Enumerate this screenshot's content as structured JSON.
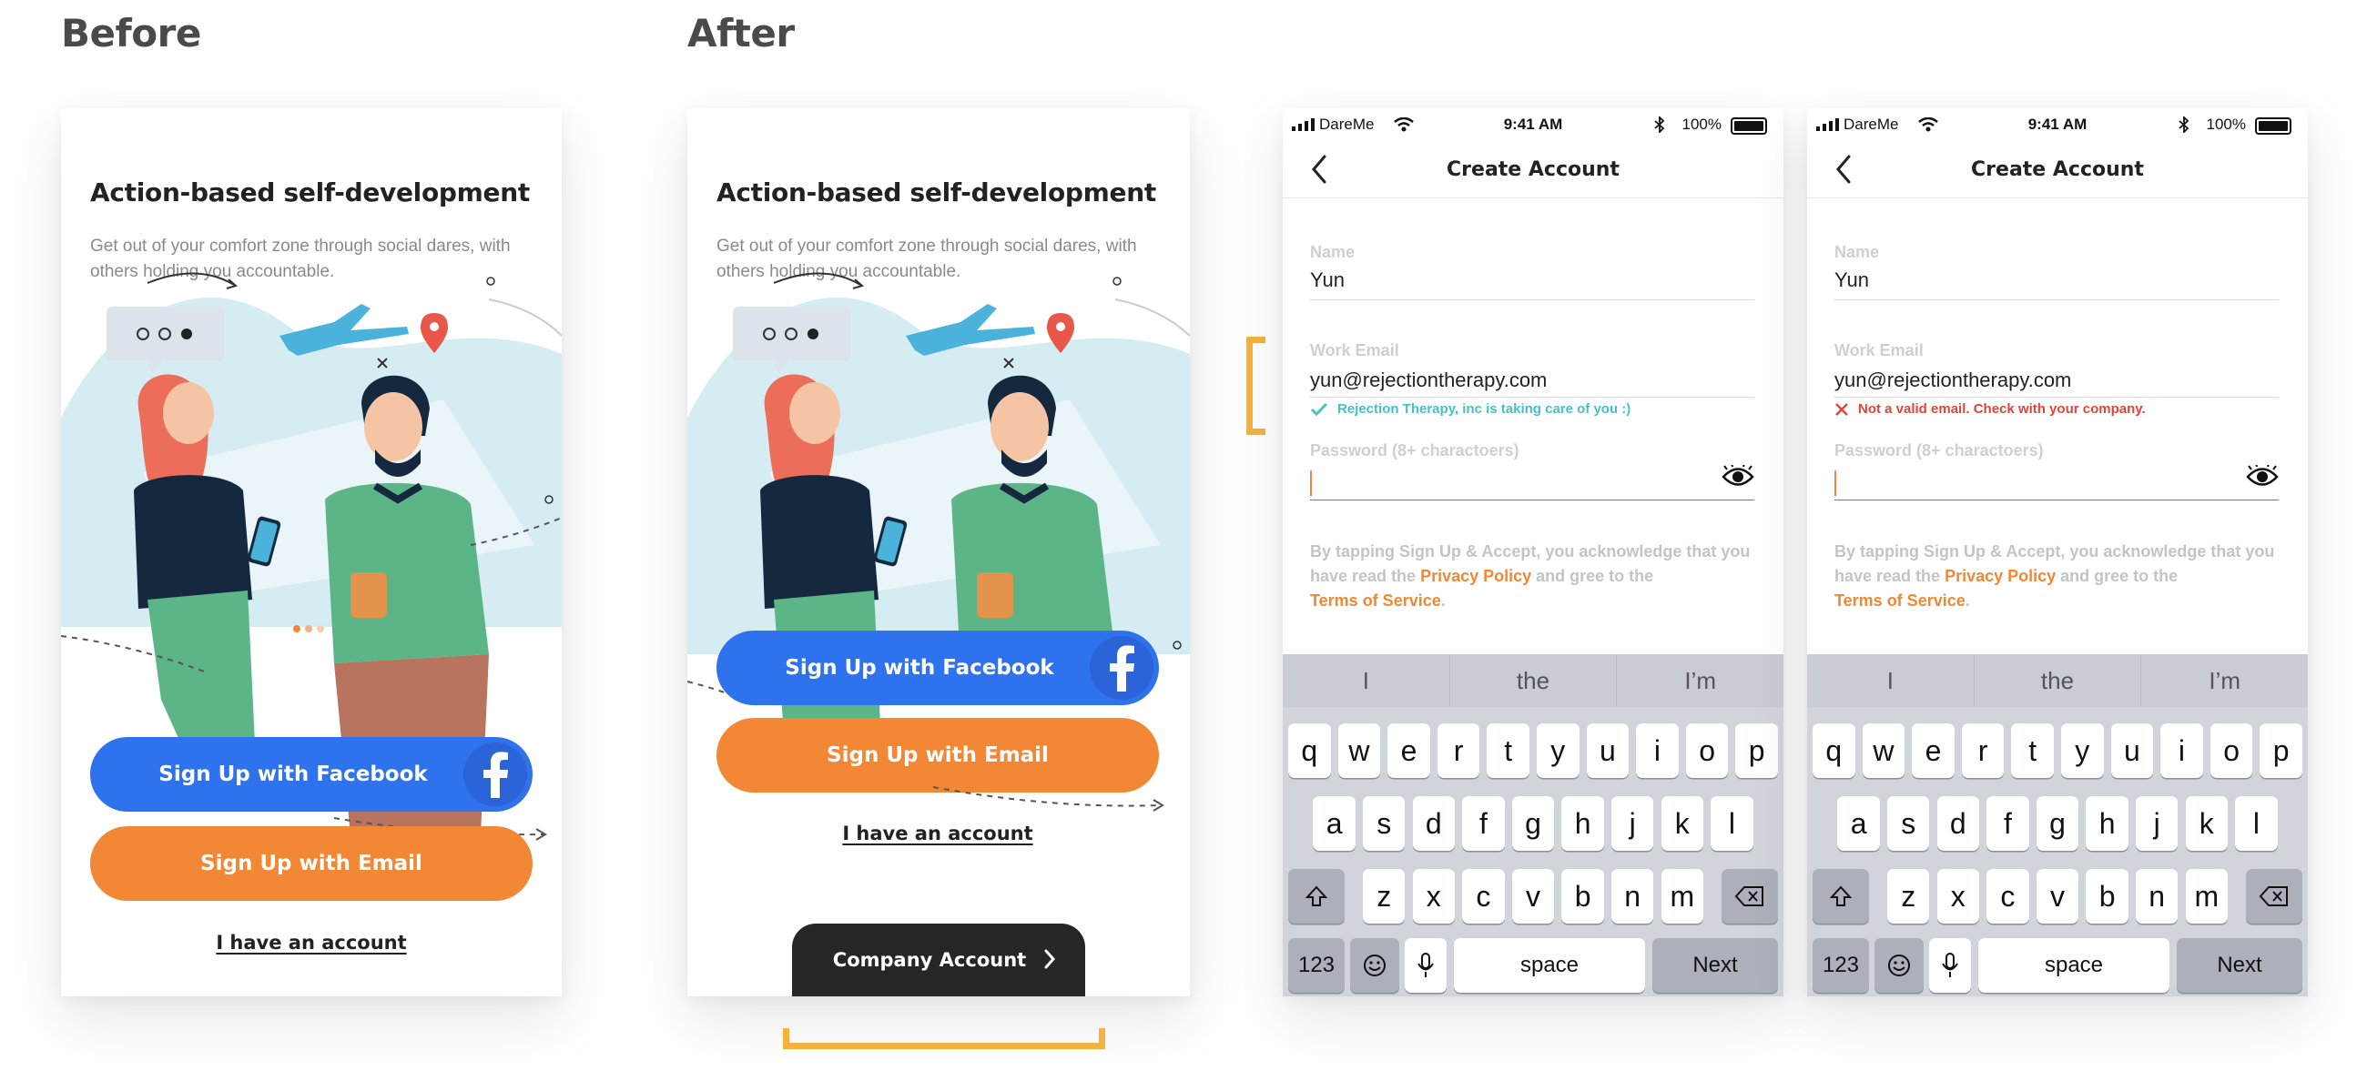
{
  "sections": {
    "before": "Before",
    "after": "After"
  },
  "onboarding": {
    "title": "Action-based self-development",
    "subtitle": "Get out of your comfort zone through social dares, with others holding you accountable.",
    "facebook_button": "Sign Up with Facebook",
    "email_button": "Sign Up with Email",
    "account_link": "I have an account",
    "company_button": "Company Account"
  },
  "phone": {
    "carrier": "DareMe",
    "time": "9:41 AM",
    "battery": "100%",
    "nav_title": "Create Account",
    "name_label": "Name",
    "name_value": "Yun",
    "email_label": "Work Email",
    "email_value": "yun@rejectiontherapy.com",
    "password_label": "Password (8+ charactoers)",
    "legal_1": "By tapping Sign Up & Accept, you acknowledge that you have read the ",
    "privacy_link": "Privacy Policy",
    "legal_2": " and gree to the ",
    "terms_link": "Terms of Service",
    "legal_3": ".",
    "success_message": "Rejection Therapy, inc is taking care of you :)",
    "error_message": "Not a valid email. Check with your company."
  },
  "keyboard": {
    "suggestions": [
      "I",
      "the",
      "I’m"
    ],
    "row1": [
      "q",
      "w",
      "e",
      "r",
      "t",
      "y",
      "u",
      "i",
      "o",
      "p"
    ],
    "row2": [
      "a",
      "s",
      "d",
      "f",
      "g",
      "h",
      "j",
      "k",
      "l"
    ],
    "row3": [
      "z",
      "x",
      "c",
      "v",
      "b",
      "n",
      "m"
    ],
    "numbers": "123",
    "space": "space",
    "next": "Next"
  },
  "colors": {
    "facebook": "#2f72ee",
    "email": "#f28735",
    "success": "#45c2c6",
    "error": "#e0453a",
    "highlight": "#f5b23c"
  }
}
